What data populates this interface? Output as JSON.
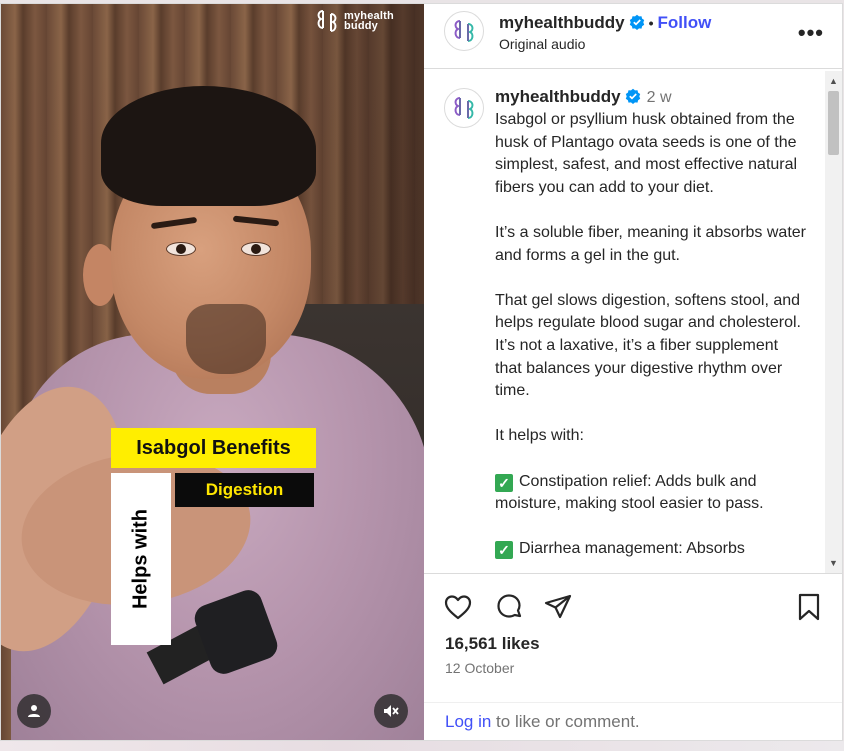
{
  "video": {
    "brand_line1": "myhealth",
    "brand_line2": "buddy",
    "overlay_title": "Isabgol Benefits",
    "overlay_tag": "Digestion",
    "overlay_side": "Helps with",
    "user_icon": "person-icon",
    "mute_icon": "speaker-muted-icon"
  },
  "header": {
    "username": "myhealthbuddy",
    "dot": "•",
    "follow_label": "Follow",
    "audio_label": "Original audio",
    "more_icon": "more-horizontal-icon",
    "more_glyph": "•••"
  },
  "caption": {
    "username": "myhealthbuddy",
    "age": "2 w",
    "paragraphs": [
      "Isabgol or psyllium husk obtained from the husk of Plantago ovata seeds is one of the simplest, safest, and most effective natural fibers you can add to your diet.",
      "It’s a soluble fiber, meaning it absorbs water and forms a gel in the gut.",
      "That gel slows digestion, softens stool, and helps regulate blood sugar and cholesterol. It’s not a laxative,  it’s a fiber supplement that balances your digestive rhythm over time.",
      "It helps with:"
    ],
    "bullets": [
      {
        "text": "Constipation relief: Adds bulk and moisture, making stool easier to pass."
      },
      {
        "text": "Diarrhea management: Absorbs"
      }
    ]
  },
  "actions": {
    "like_icon": "heart-icon",
    "comment_icon": "comment-icon",
    "share_icon": "send-icon",
    "save_icon": "bookmark-icon",
    "likes": "16,561 likes",
    "date": "12 October",
    "login_link": "Log in",
    "login_rest": " to like or comment."
  },
  "scroll": {
    "up": "▲",
    "down": "▼"
  },
  "colors": {
    "accent": "#4150f7",
    "verified": "#0095f6",
    "banner_yellow": "#ffee00",
    "check_green": "#33a853"
  }
}
